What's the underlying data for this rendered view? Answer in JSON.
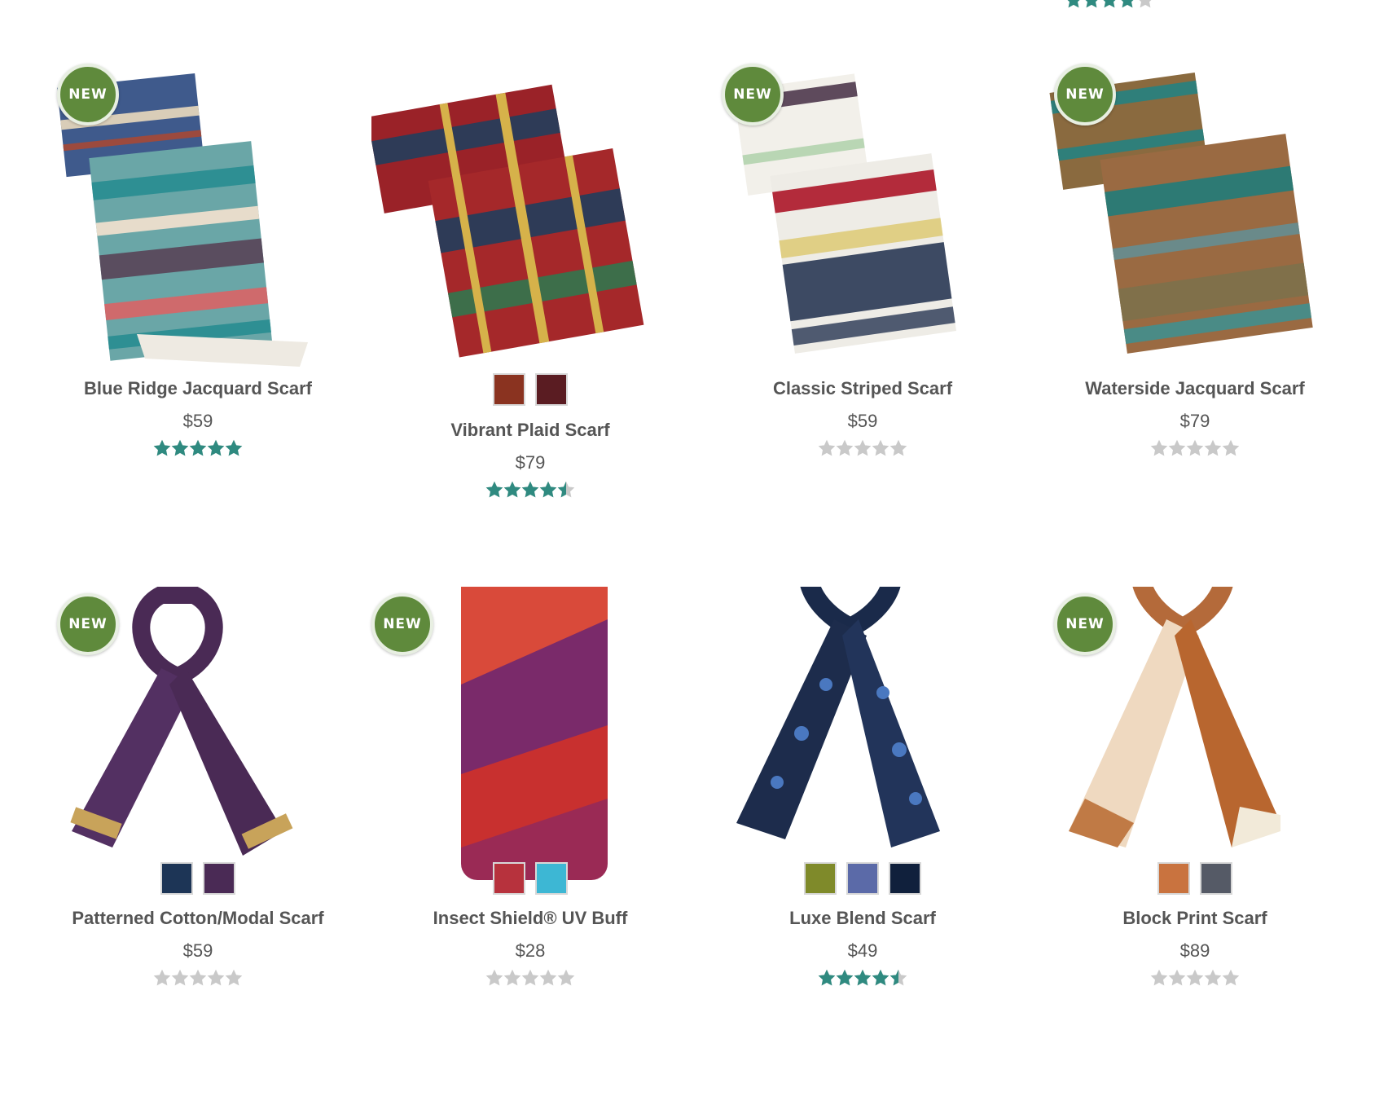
{
  "colors": {
    "star_filled": "#2f8a80",
    "star_empty": "#c9c9c9",
    "badge": "#5f8a3c"
  },
  "top_partial_rating": 4,
  "products": [
    {
      "badge": "NEW",
      "name": "Blue Ridge Jacquard Scarf",
      "price": "$59",
      "rating": 5,
      "swatches": [],
      "image": "blue-ridge-scarf"
    },
    {
      "badge": "",
      "name": "Vibrant Plaid Scarf",
      "price": "$79",
      "rating": 4.5,
      "swatches": [
        "#8a3320",
        "#5a1c22"
      ],
      "image": "plaid-scarf"
    },
    {
      "badge": "NEW",
      "name": "Classic Striped Scarf",
      "price": "$59",
      "rating": 0,
      "swatches": [],
      "image": "striped-scarf"
    },
    {
      "badge": "NEW",
      "name": "Waterside Jacquard Scarf",
      "price": "$79",
      "rating": 0,
      "swatches": [],
      "image": "waterside-scarf"
    },
    {
      "badge": "NEW",
      "name": "Patterned Cotton/Modal Scarf",
      "price": "$59",
      "rating": 0,
      "swatches": [
        "#1d3556",
        "#4a2a55"
      ],
      "image": "patterned-scarf"
    },
    {
      "badge": "NEW",
      "name": "Insect Shield® UV Buff",
      "price": "$28",
      "rating": 0,
      "swatches": [
        "#b7323d",
        "#3db7d4"
      ],
      "image": "uv-buff"
    },
    {
      "badge": "",
      "name": "Luxe Blend Scarf",
      "price": "$49",
      "rating": 4.5,
      "swatches": [
        "#7f8a2a",
        "#5b6aa8",
        "#10203c"
      ],
      "image": "luxe-scarf"
    },
    {
      "badge": "NEW",
      "name": "Block Print Scarf",
      "price": "$89",
      "rating": 0,
      "swatches": [
        "#c9733f",
        "#555a66"
      ],
      "image": "block-print-scarf"
    }
  ]
}
